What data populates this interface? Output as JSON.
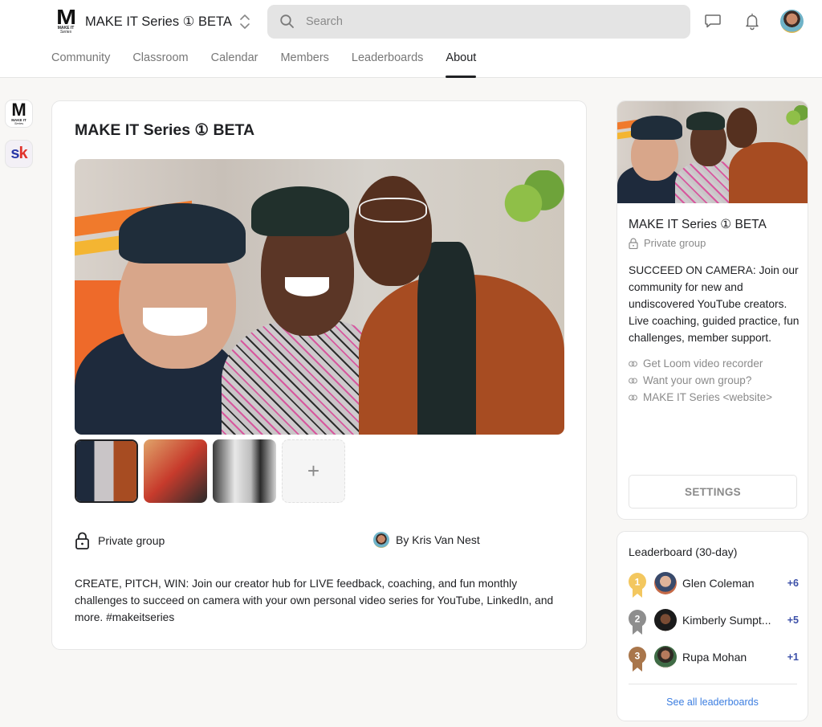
{
  "header": {
    "logo": {
      "letter": "M",
      "line1": "MAKE IT",
      "line2": "Series"
    },
    "group_title": "MAKE IT Series ① BETA",
    "search": {
      "placeholder": "Search",
      "value": ""
    },
    "icons": [
      "chevron-updown-icon",
      "search-icon",
      "chat-icon",
      "bell-icon",
      "user-avatar"
    ]
  },
  "tabs": [
    {
      "label": "Community",
      "active": false
    },
    {
      "label": "Classroom",
      "active": false
    },
    {
      "label": "Calendar",
      "active": false
    },
    {
      "label": "Members",
      "active": false
    },
    {
      "label": "Leaderboards",
      "active": false
    },
    {
      "label": "About",
      "active": true
    }
  ],
  "rail": [
    {
      "name": "MAKE IT Series",
      "letter": "M",
      "line1": "MAKE IT",
      "line2": "Series"
    },
    {
      "name": "sk",
      "text_s": "s",
      "text_k": "k"
    }
  ],
  "main": {
    "title": "MAKE IT Series ① BETA",
    "thumbnails": 3,
    "add_label": "+",
    "privacy": "Private group",
    "owner": "By Kris Van Nest",
    "description": "CREATE, PITCH, WIN: Join our creator hub for LIVE feedback, coaching, and fun monthly challenges to succeed on camera with your own personal video series for YouTube, LinkedIn, and more. #makeitseries"
  },
  "sidebar": {
    "title": "MAKE IT Series ① BETA",
    "privacy": "Private group",
    "description": "SUCCEED ON CAMERA: Join our community for new and undiscovered YouTube creators. Live coaching, guided practice, fun challenges, member support.",
    "links": [
      "Get Loom video recorder",
      "Want your own group?",
      "MAKE IT Series <website>"
    ],
    "settings_label": "SETTINGS"
  },
  "leaderboard": {
    "title": "Leaderboard (30-day)",
    "entries": [
      {
        "rank": "1",
        "name": "Glen Coleman",
        "points": "+6",
        "medal_color": "#f3c75f"
      },
      {
        "rank": "2",
        "name": "Kimberly Sumpt...",
        "points": "+5",
        "medal_color": "#8e8e8e"
      },
      {
        "rank": "3",
        "name": "Rupa Mohan",
        "points": "+1",
        "medal_color": "#a9764b"
      }
    ],
    "see_all": "See all leaderboards"
  },
  "colors": {
    "accent_link": "#3b7de0",
    "points": "#3b4fa8",
    "background": "#f8f7f5"
  }
}
